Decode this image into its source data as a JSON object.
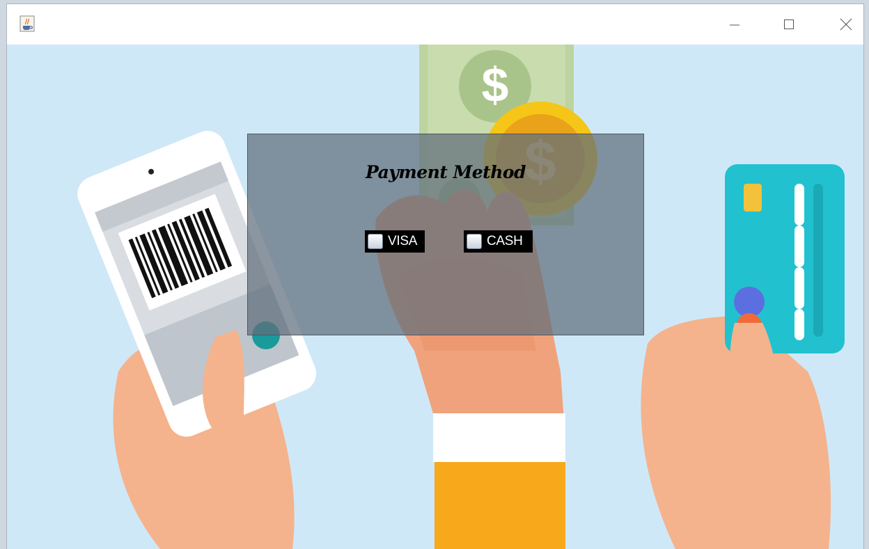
{
  "window": {
    "icon": "java-cup-icon",
    "controls": [
      "minimize-icon",
      "maximize-icon",
      "close-icon"
    ]
  },
  "panel": {
    "title": "Payment Method",
    "options": [
      {
        "label": "VISA",
        "checked": false
      },
      {
        "label": "CASH",
        "checked": false
      }
    ]
  },
  "background": {
    "illustration": "payment-hands-illustration",
    "sky_color": "#cfe8f8"
  }
}
